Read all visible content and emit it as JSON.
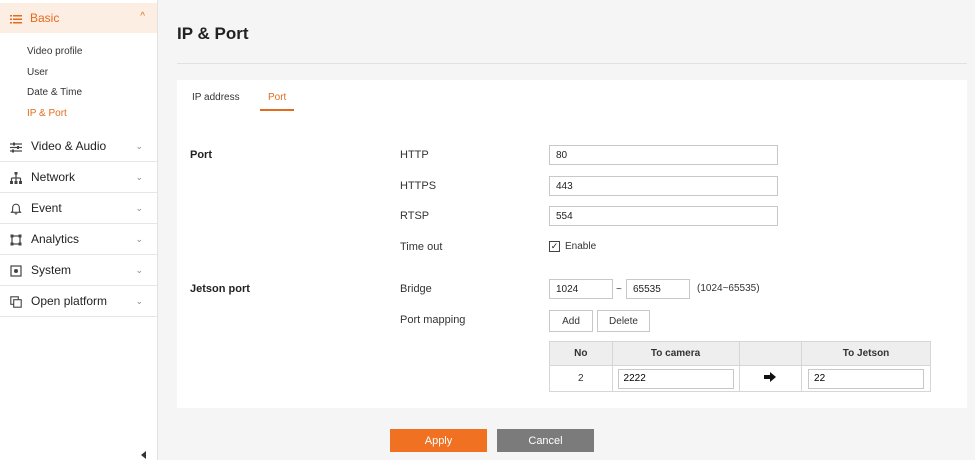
{
  "sidebar": {
    "basic": {
      "label": "Basic",
      "icon": "list-icon",
      "children": [
        "Video profile",
        "User",
        "Date & Time",
        "IP & Port"
      ],
      "active_child": "IP & Port"
    },
    "items": [
      {
        "label": "Video & Audio",
        "icon": "sliders-icon"
      },
      {
        "label": "Network",
        "icon": "network-icon"
      },
      {
        "label": "Event",
        "icon": "bell-icon"
      },
      {
        "label": "Analytics",
        "icon": "analytics-icon"
      },
      {
        "label": "System",
        "icon": "system-icon"
      },
      {
        "label": "Open platform",
        "icon": "open-platform-icon"
      }
    ]
  },
  "page": {
    "title": "IP & Port",
    "tabs": [
      {
        "label": "IP address",
        "active": false
      },
      {
        "label": "Port",
        "active": true
      }
    ]
  },
  "port_section": {
    "label": "Port",
    "fields": [
      {
        "label": "HTTP",
        "value": "80"
      },
      {
        "label": "HTTPS",
        "value": "443"
      },
      {
        "label": "RTSP",
        "value": "554"
      }
    ],
    "timeout": {
      "label": "Time out",
      "checkbox_label": "Enable",
      "checked": true
    }
  },
  "jetson_section": {
    "label": "Jetson port",
    "bridge": {
      "label": "Bridge",
      "from": "1024",
      "separator": "~",
      "to": "65535",
      "range_note": "(1024~65535)"
    },
    "port_mapping": {
      "label": "Port mapping",
      "add_label": "Add",
      "delete_label": "Delete",
      "columns": {
        "no": "No",
        "to_camera": "To camera",
        "arrow": "",
        "to_jetson": "To Jetson"
      },
      "rows": [
        {
          "no": "2",
          "to_camera": "2222",
          "to_jetson": "22"
        }
      ]
    }
  },
  "actions": {
    "apply_label": "Apply",
    "cancel_label": "Cancel"
  },
  "colors": {
    "accent": "#f07122",
    "cancel": "#7b7b7b"
  }
}
